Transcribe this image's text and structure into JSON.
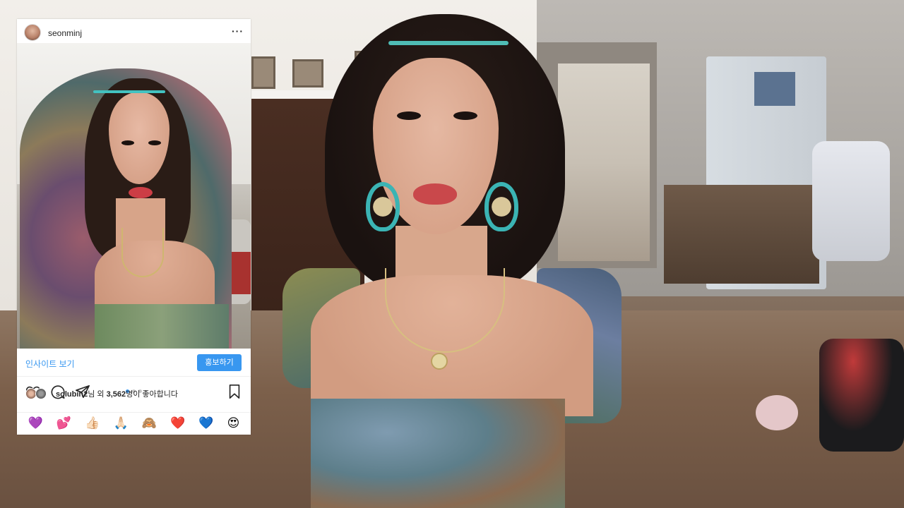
{
  "post": {
    "username": "seonminj",
    "more_label": "···",
    "insights_label": "인사이트 보기",
    "promote_label": "홍보하기",
    "carousel": {
      "count": 4,
      "active_index": 0
    },
    "likes": {
      "user": "solubin2",
      "middle_text": "님 외 ",
      "count": "3,562",
      "suffix_text": "명이 좋아합니다"
    },
    "quick_reactions": [
      "💜",
      "💕",
      "👍🏻",
      "🙏🏻",
      "🙈",
      "❤️",
      "💙",
      "😍"
    ]
  },
  "icons": {
    "like": "heart-icon",
    "comment": "comment-icon",
    "share": "send-icon",
    "save": "bookmark-icon"
  },
  "colors": {
    "instagram_blue": "#3897f0",
    "text": "#262626",
    "divider": "#efefef"
  }
}
